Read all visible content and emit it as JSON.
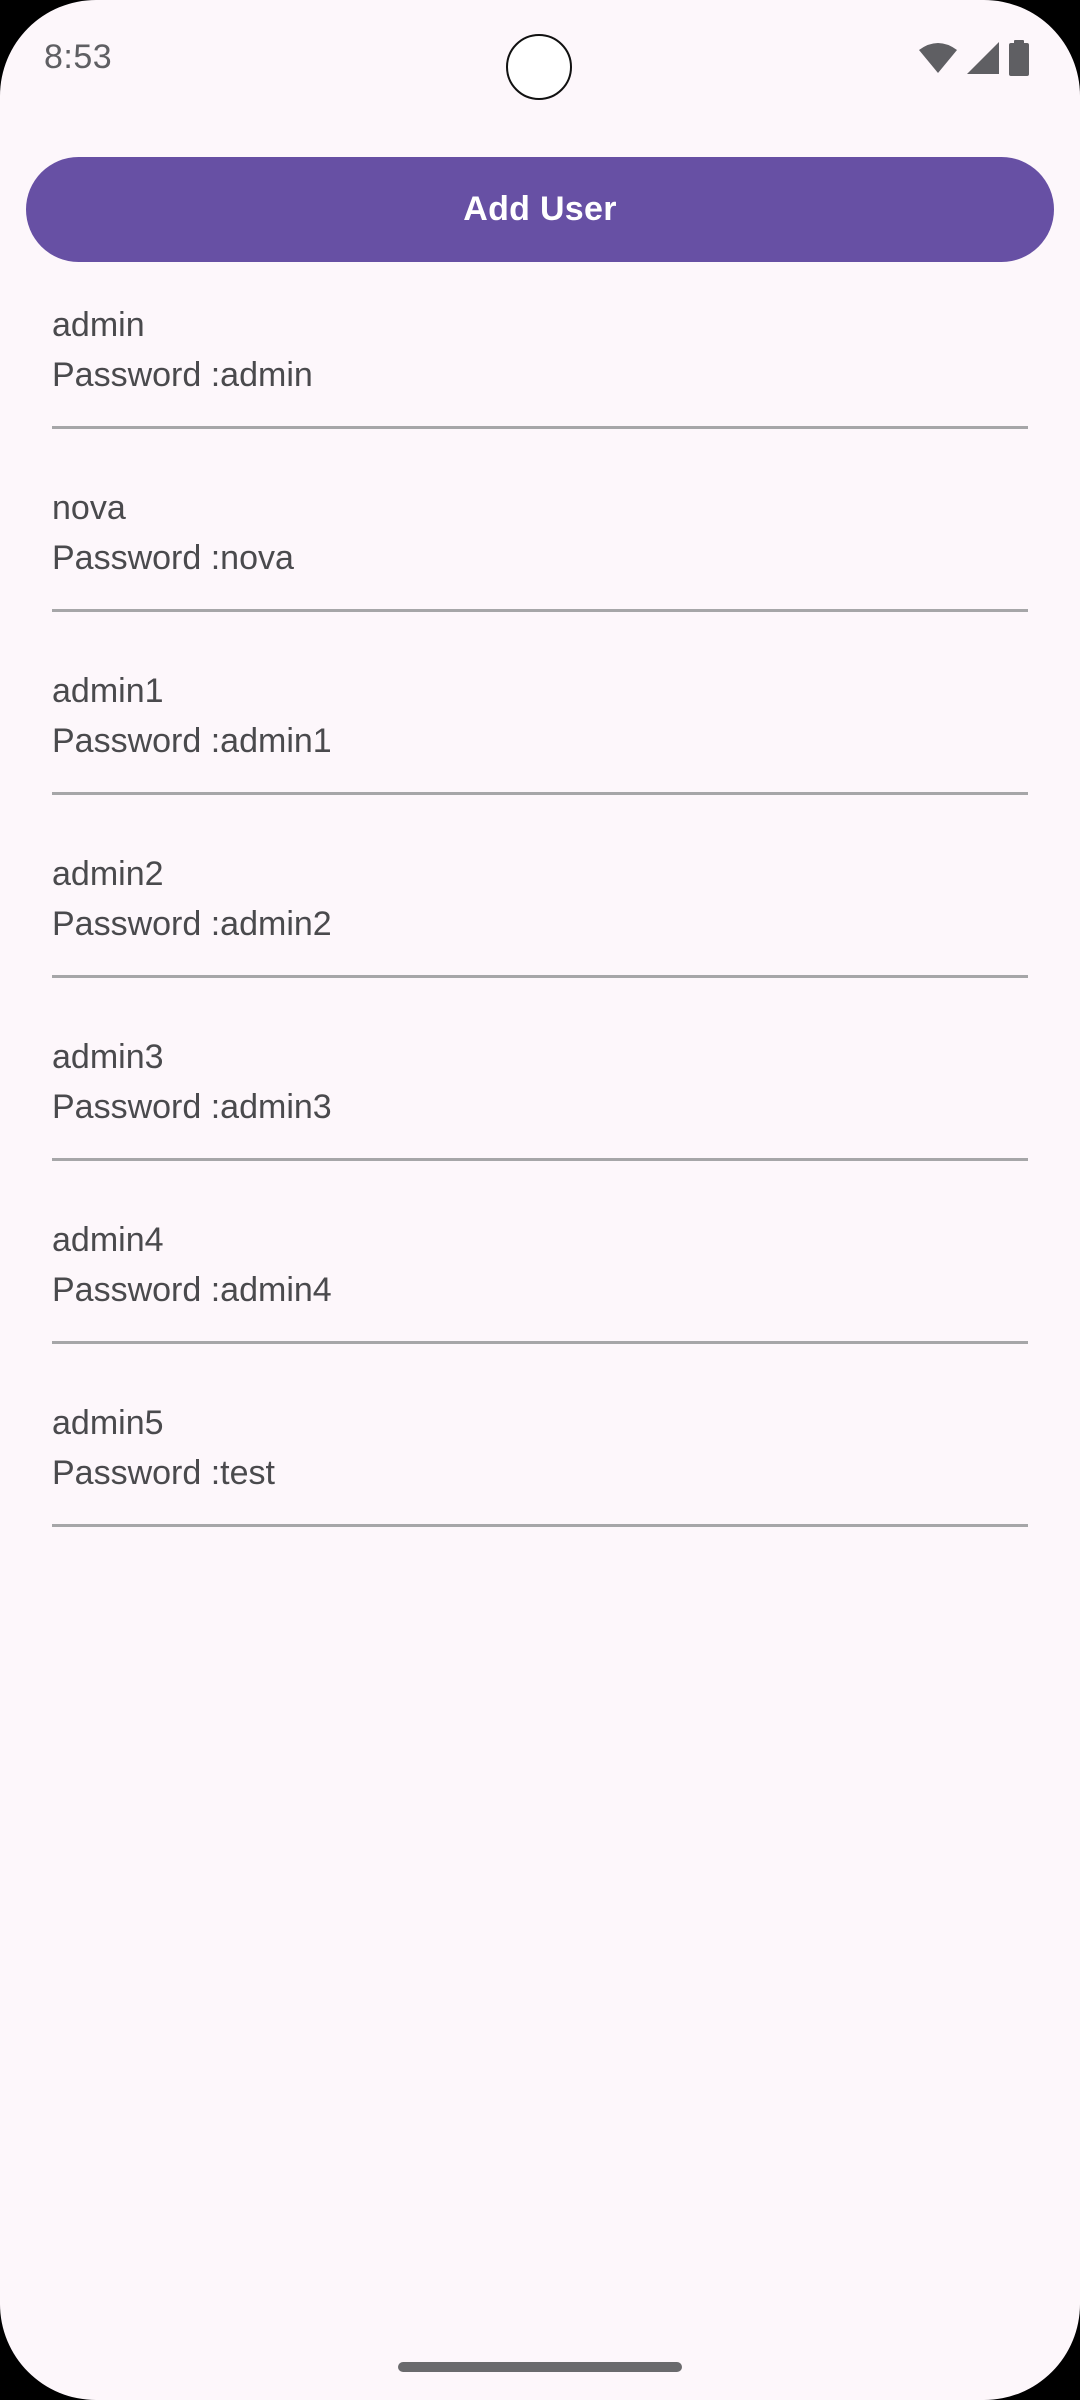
{
  "status_bar": {
    "time": "8:53",
    "icons": [
      "wifi-icon",
      "cellular-signal-icon",
      "battery-icon"
    ]
  },
  "colors": {
    "background": "#fdf7fb",
    "accent": "#6750a4",
    "text": "#4a4a4d",
    "divider": "#a6a6a8"
  },
  "add_user_button": {
    "label": "Add User"
  },
  "users": [
    {
      "name": "admin",
      "password_text": "Password :admin"
    },
    {
      "name": "nova",
      "password_text": "Password :nova"
    },
    {
      "name": "admin1",
      "password_text": "Password :admin1"
    },
    {
      "name": "admin2",
      "password_text": "Password :admin2"
    },
    {
      "name": "admin3",
      "password_text": "Password :admin3"
    },
    {
      "name": "admin4",
      "password_text": "Password :admin4"
    },
    {
      "name": "admin5",
      "password_text": "Password :test"
    }
  ]
}
